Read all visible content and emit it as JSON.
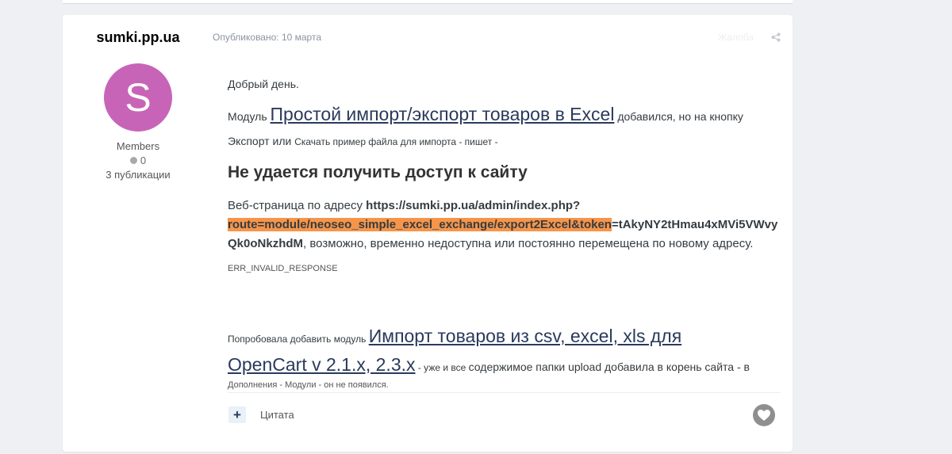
{
  "author": {
    "name": "sumki.pp.ua",
    "avatar_letter": "S",
    "avatar_color": "#c864b8",
    "group": "Members",
    "reputation": "0",
    "posts": "3 публикации"
  },
  "post": {
    "published": "Опубликовано: 10 марта",
    "report": "Жалоба",
    "greeting": "Добрый день.",
    "module_prefix": "Модуль ",
    "module_link": "Простой импорт/экспорт товаров в Excel",
    "module_suffix": " добавился, но на кнопку",
    "export_text": "Экспорт или ",
    "export_small": "Скачать пример файла для импорта - пишет -",
    "error_heading": "Не удается получить доступ к сайту",
    "web_prefix": "Веб-страница по адресу ",
    "url_part1": "https://sumki.pp.ua/admin/index.php?",
    "url_highlight": "route=module/neoseo_simple_excel_exchange/export2Excel&token",
    "url_part2": "=tAkyNY2tHmau4xMVi5VWvy",
    "url_part3": "Qk0oNkzhdM",
    "web_suffix": ", возможно, временно недоступна или постоянно перемещена по новому адресу.",
    "error_code": "ERR_INVALID_RESPONSE",
    "try_prefix": "Попробовала добавить модуль ",
    "try_link1": "Импорт товаров из csv, excel, xls для",
    "try_link2": "OpenCart v 2.1.x, 2.3.x",
    "try_mid_small": " -  уже и все ",
    "try_mid": "содержимое папки upload  добавила в корень сайта - в",
    "try_end": "Дополнения - Модули - он не появился."
  },
  "actions": {
    "plus": "+",
    "quote": "Цитата"
  },
  "colors": {
    "highlight": "#f6954a",
    "link": "#2a3a5c"
  }
}
